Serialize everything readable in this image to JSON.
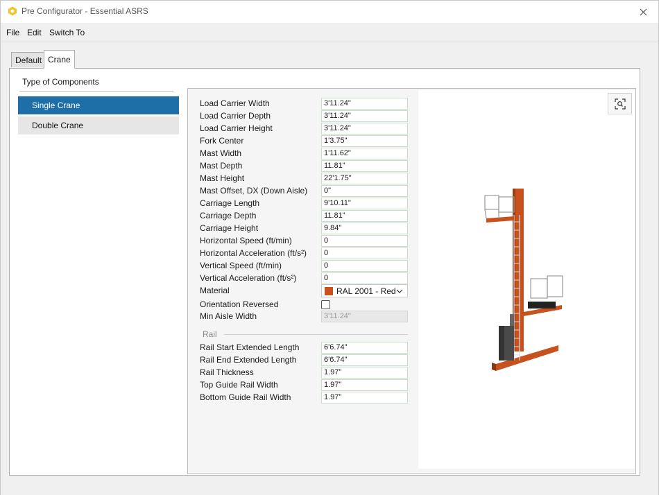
{
  "window": {
    "title": "Pre Configurator - Essential ASRS",
    "icon": "hexagon-app-icon",
    "accent": "#1e6fa8"
  },
  "menu": [
    "File",
    "Edit",
    "Switch To"
  ],
  "tabs": [
    {
      "label": "Default",
      "active": false
    },
    {
      "label": "Crane",
      "active": true
    }
  ],
  "components": {
    "header": "Type of Components",
    "items": [
      {
        "label": "Single Crane",
        "selected": true
      },
      {
        "label": "Double Crane",
        "selected": false
      }
    ]
  },
  "properties": [
    {
      "label": "Load Carrier Width",
      "value": "3'11.24\""
    },
    {
      "label": "Load Carrier Depth",
      "value": "3'11.24\""
    },
    {
      "label": "Load Carrier Height",
      "value": "3'11.24\""
    },
    {
      "label": "Fork Center",
      "value": "1'3.75\""
    },
    {
      "label": "Mast Width",
      "value": "1'11.62\""
    },
    {
      "label": "Mast Depth",
      "value": "11.81\""
    },
    {
      "label": "Mast Height",
      "value": "22'1.75\""
    },
    {
      "label": "Mast Offset, DX (Down Aisle)",
      "value": "0\""
    },
    {
      "label": "Carriage Length",
      "value": "9'10.11\""
    },
    {
      "label": "Carriage Depth",
      "value": "11.81\""
    },
    {
      "label": "Carriage Height",
      "value": "9.84\""
    },
    {
      "label": "Horizontal Speed (ft/min)",
      "value": "0"
    },
    {
      "label": "Horizontal Acceleration (ft/s²)",
      "value": "0"
    },
    {
      "label": "Vertical Speed (ft/min)",
      "value": "0"
    },
    {
      "label": "Vertical Acceleration (ft/s²)",
      "value": "0"
    }
  ],
  "material": {
    "label": "Material",
    "value": "RAL 2001 - Red",
    "color": "#c8521e"
  },
  "orientation": {
    "label": "Orientation Reversed",
    "checked": false
  },
  "min_aisle": {
    "label": "Min Aisle Width",
    "value": "3'11.24\""
  },
  "rail": {
    "title": "Rail",
    "properties": [
      {
        "label": "Rail Start Extended Length",
        "value": "6'6.74\""
      },
      {
        "label": "Rail End Extended Length",
        "value": "6'6.74\""
      },
      {
        "label": "Rail Thickness",
        "value": "1.97\""
      },
      {
        "label": "Top Guide Rail Width",
        "value": "1.97\""
      },
      {
        "label": "Bottom Guide Rail Width",
        "value": "1.97\""
      }
    ]
  },
  "viewport": {
    "zoom_icon": "zoom-fit-icon",
    "model_color": "#c8521e"
  }
}
